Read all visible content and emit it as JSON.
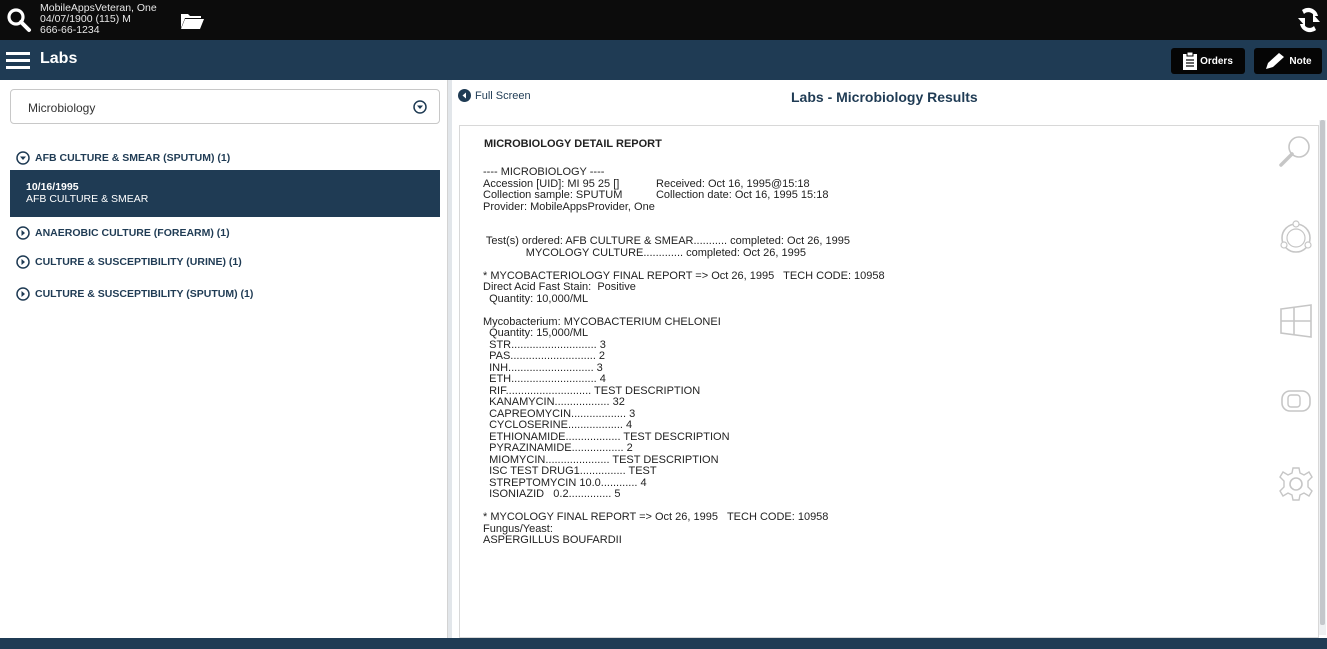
{
  "patient": {
    "name": "MobileAppsVeteran, One",
    "dob_line": "04/07/1900 (115) M",
    "ssn": "666-66-1234"
  },
  "header": {
    "title": "Labs",
    "orders_label": "Orders",
    "note_label": "Note"
  },
  "lab_selector": {
    "value": "Microbiology"
  },
  "groups": [
    {
      "label": "AFB CULTURE & SMEAR (SPUTUM) (1)",
      "expanded": true
    },
    {
      "label": "ANAEROBIC CULTURE (FOREARM) (1)",
      "expanded": false
    },
    {
      "label": "CULTURE & SUSCEPTIBILITY (URINE) (1)",
      "expanded": false
    },
    {
      "label": "CULTURE & SUSCEPTIBILITY (SPUTUM) (1)",
      "expanded": false
    }
  ],
  "selected_item": {
    "date": "10/16/1995",
    "name": "AFB CULTURE & SMEAR"
  },
  "right": {
    "fullscreen_label": "Full Screen",
    "title": "Labs - Microbiology Results"
  },
  "report": {
    "heading": "MICROBIOLOGY DETAIL REPORT",
    "body": "---- MICROBIOLOGY ----\nAccession [UID]: MI 95 25 []            Received: Oct 16, 1995@15:18\nCollection sample: SPUTUM           Collection date: Oct 16, 1995 15:18\nProvider: MobileAppsProvider, One\n\n\n Test(s) ordered: AFB CULTURE & SMEAR........... completed: Oct 26, 1995\n              MYCOLOGY CULTURE............. completed: Oct 26, 1995\n\n* MYCOBACTERIOLOGY FINAL REPORT => Oct 26, 1995   TECH CODE: 10958\nDirect Acid Fast Stain:  Positive\n  Quantity: 10,000/ML\n\nMycobacterium: MYCOBACTERIUM CHELONEI\n  Quantity: 15,000/ML\n  STR............................ 3\n  PAS............................ 2\n  INH............................ 3\n  ETH............................ 4\n  RIF............................ TEST DESCRIPTION\n  KANAMYCIN.................. 32\n  CAPREOMYCIN.................. 3\n  CYCLOSERINE.................. 4\n  ETHIONAMIDE.................. TEST DESCRIPTION\n  PYRAZINAMIDE................. 2\n  MIOMYCIN..................... TEST DESCRIPTION\n  ISC TEST DRUG1............... TEST\n  STREPTOMYCIN 10.0............ 4\n  ISONIAZID   0.2.............. 5\n\n* MYCOLOGY FINAL REPORT => Oct 26, 1995   TECH CODE: 10958\nFungus/Yeast:\nASPERGILLUS BOUFARDII"
  },
  "side_icons": [
    "magnifier-icon",
    "circle-ring-icon",
    "windows-icon",
    "device-icon",
    "gear-icon"
  ]
}
